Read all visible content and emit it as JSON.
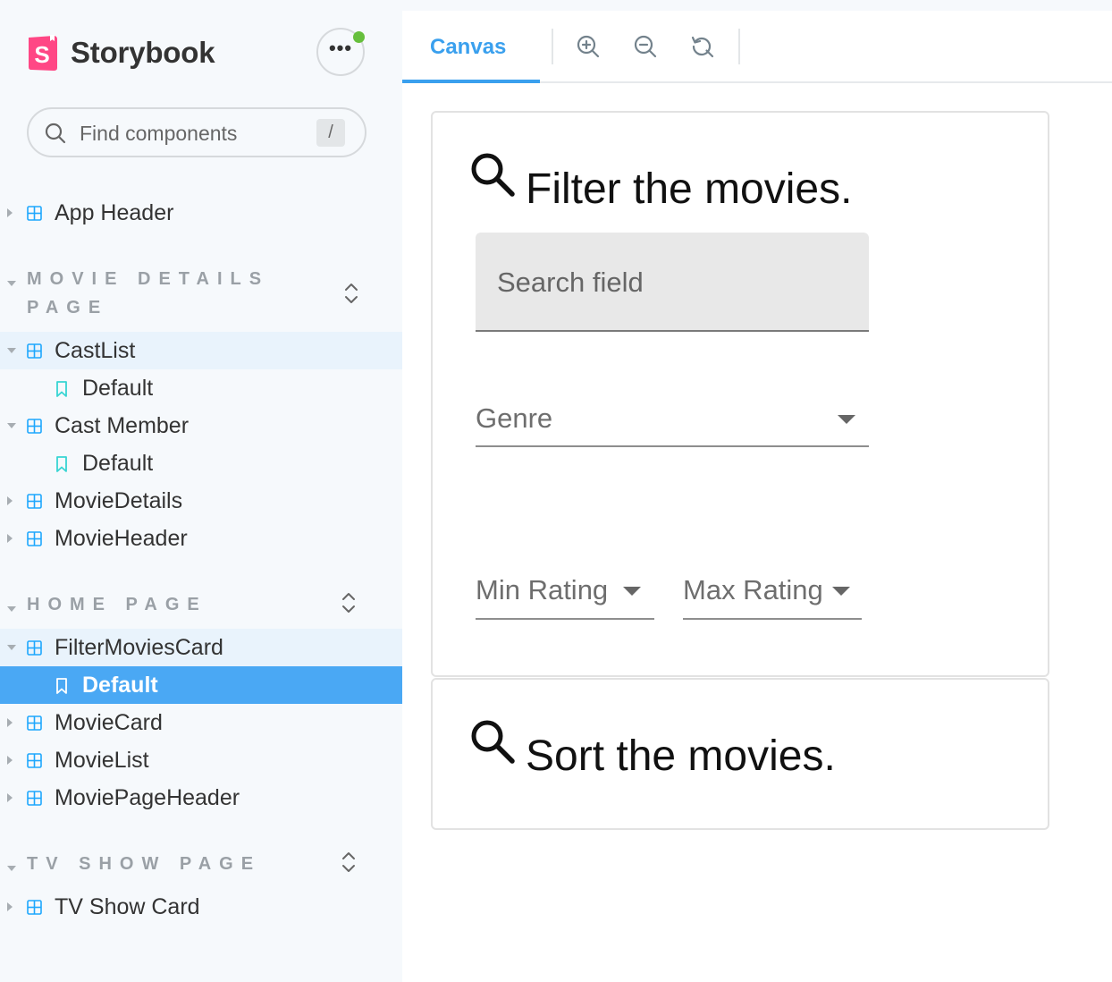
{
  "brand": {
    "name": "Storybook",
    "logo_letter": "S",
    "logo_color": "#FF4785"
  },
  "menu": {
    "dots": "•••",
    "notification_color": "#66BF3C"
  },
  "search": {
    "placeholder": "Find components",
    "shortcut": "/"
  },
  "sidebar": {
    "top_items": [
      {
        "label": "App Header"
      }
    ],
    "sections": [
      {
        "title": "MOVIE DETAILS PAGE",
        "items": [
          {
            "label": "CastList",
            "expanded": true,
            "stories": [
              "Default"
            ]
          },
          {
            "label": "Cast Member",
            "expanded": true,
            "stories": [
              "Default"
            ]
          },
          {
            "label": "MovieDetails",
            "expanded": false
          },
          {
            "label": "MovieHeader",
            "expanded": false
          }
        ]
      },
      {
        "title": "HOME PAGE",
        "items": [
          {
            "label": "FilterMoviesCard",
            "expanded": true,
            "stories": [
              "Default"
            ],
            "selected_story": "Default"
          },
          {
            "label": "MovieCard",
            "expanded": false
          },
          {
            "label": "MovieList",
            "expanded": false
          },
          {
            "label": "MoviePageHeader",
            "expanded": false
          }
        ]
      },
      {
        "title": "TV SHOW PAGE",
        "items": [
          {
            "label": "TV Show Card",
            "expanded": false
          }
        ]
      }
    ]
  },
  "toolbar": {
    "active_tab": "Canvas",
    "accent_color": "#3AA0EE",
    "icons": [
      "zoom-in-icon",
      "zoom-out-icon",
      "reset-zoom-icon"
    ]
  },
  "filter_card": {
    "title": "Filter the movies.",
    "search_label": "Search field",
    "genre_label": "Genre",
    "min_rating_label": "Min Rating",
    "max_rating_label": "Max Rating"
  },
  "sort_card": {
    "title": "Sort the movies."
  }
}
